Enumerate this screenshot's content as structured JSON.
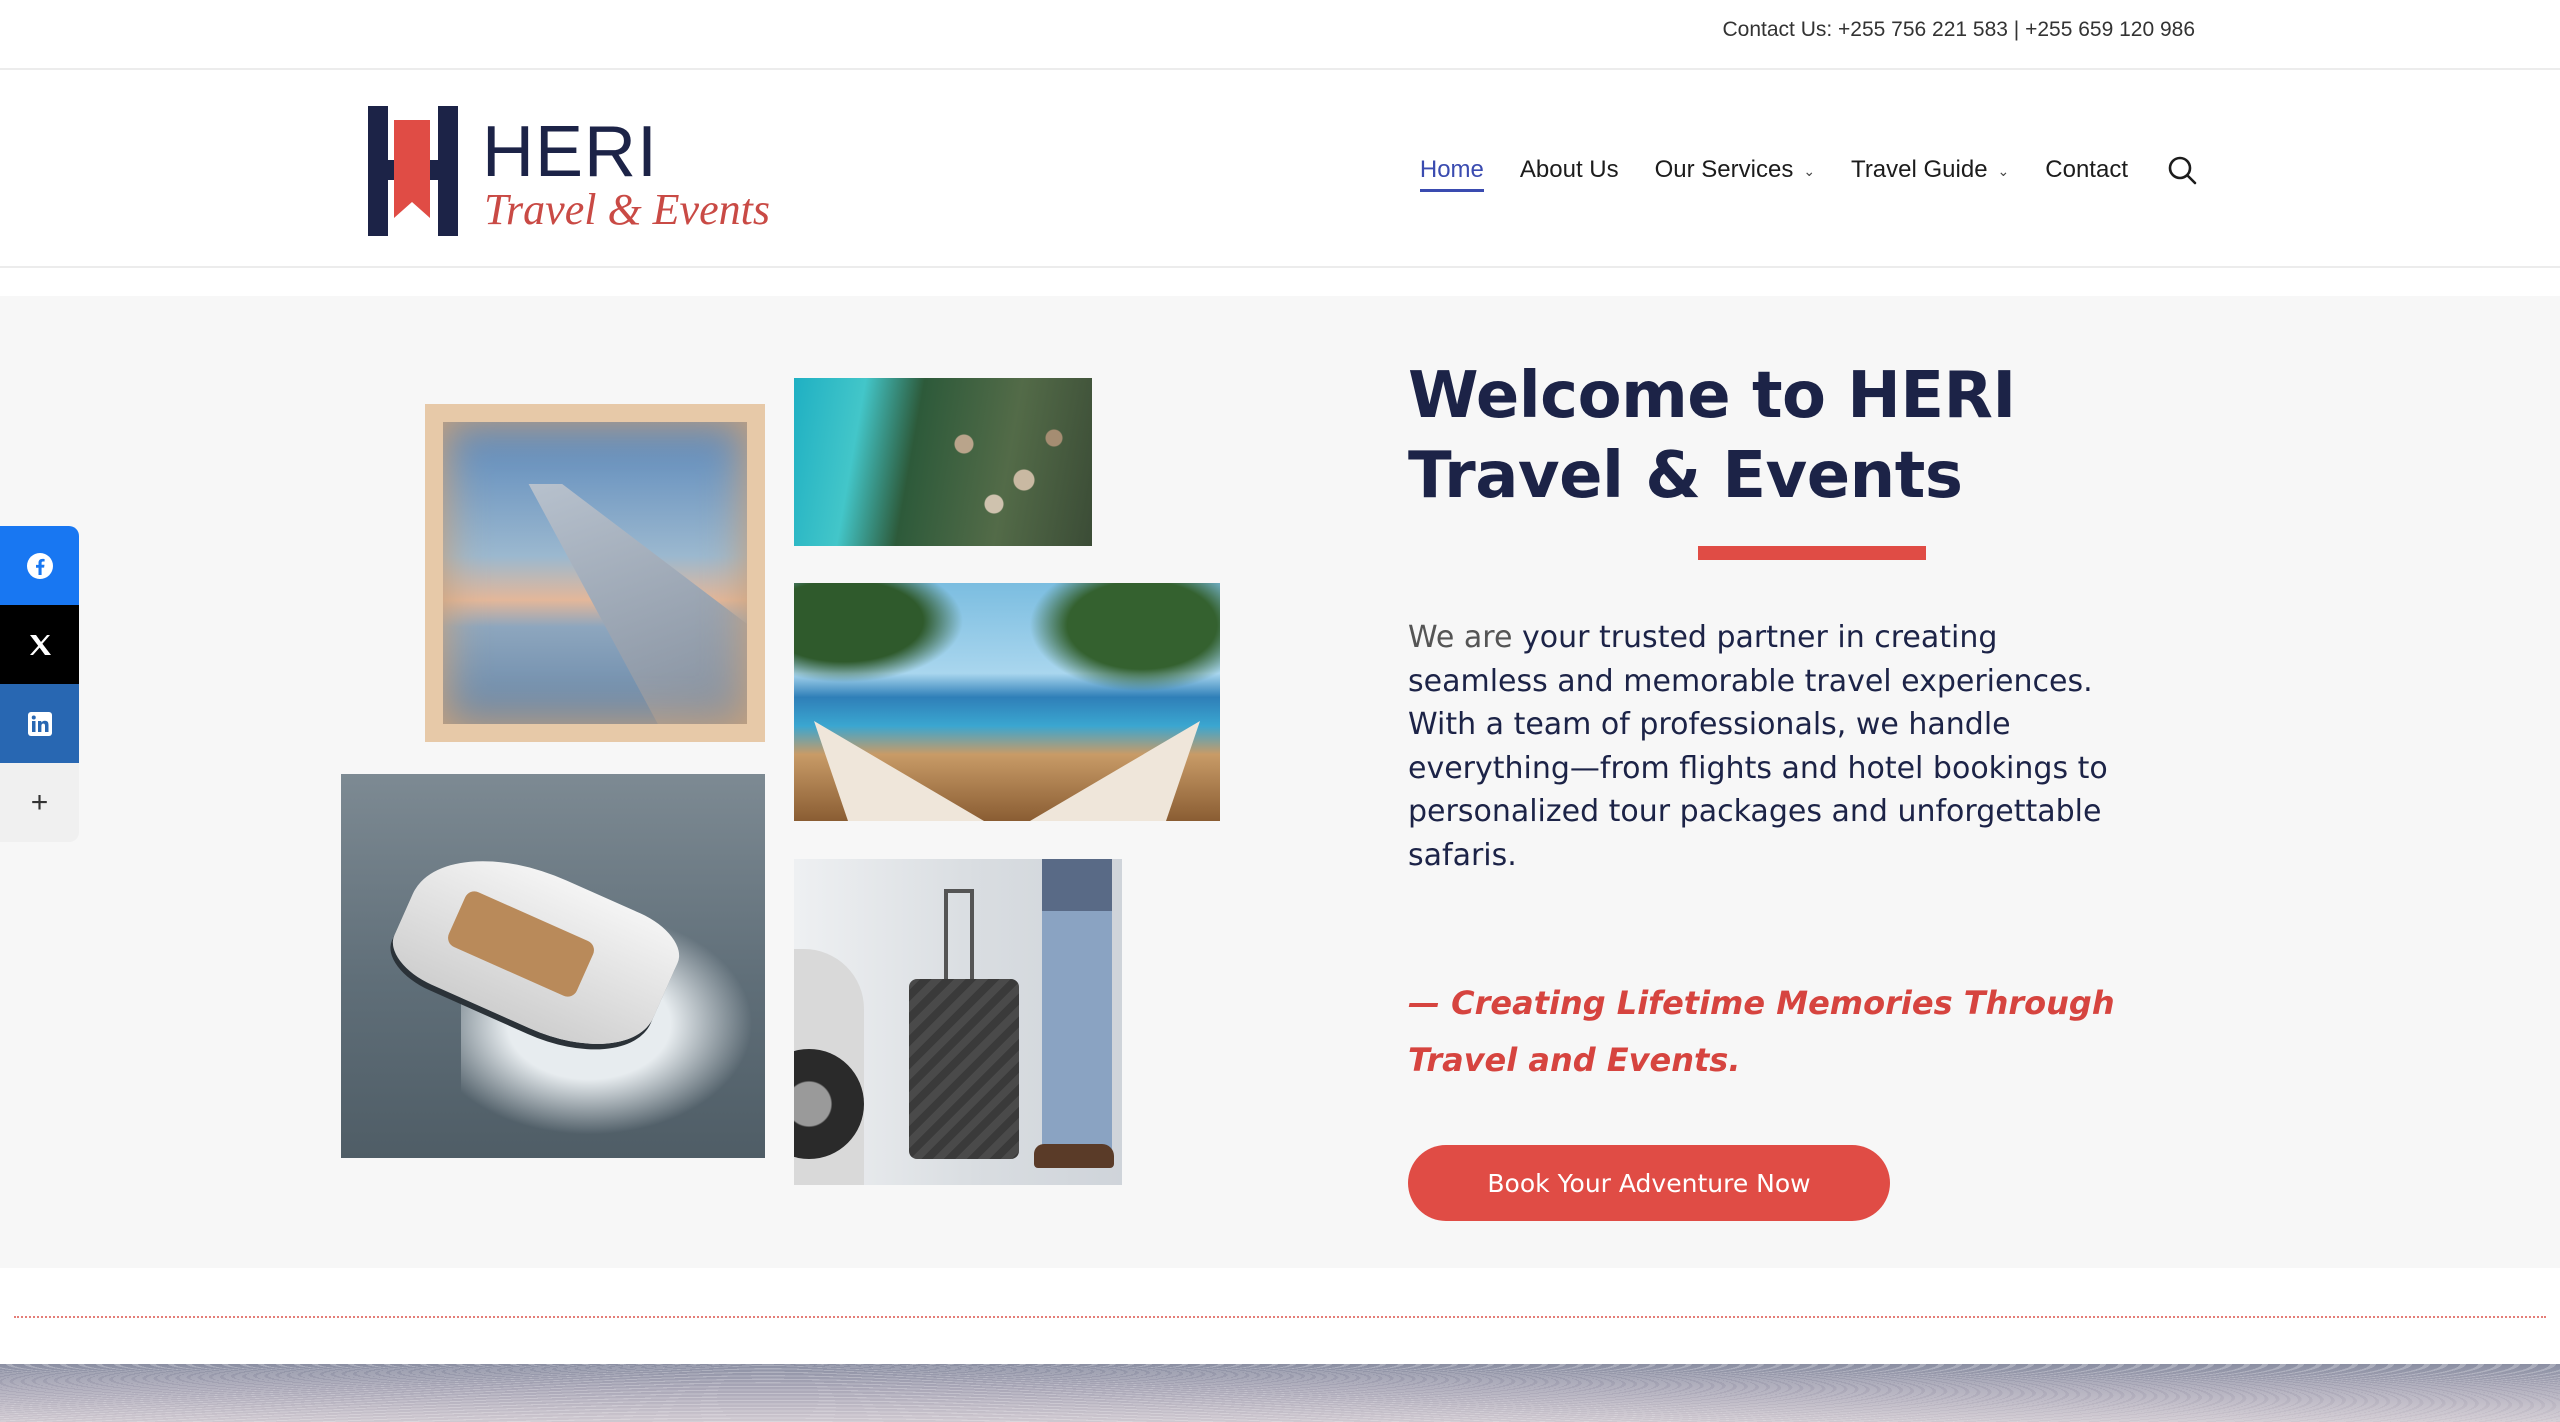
{
  "topbar": {
    "contact": "Contact Us: +255 756 221 583 | +255 659 120 986"
  },
  "logo": {
    "name": "HERI",
    "tagline": "Travel & Events"
  },
  "nav": {
    "items": [
      {
        "label": "Home",
        "active": true
      },
      {
        "label": "About Us"
      },
      {
        "label": "Our Services",
        "dropdown": true
      },
      {
        "label": "Travel Guide",
        "dropdown": true
      },
      {
        "label": "Contact"
      }
    ]
  },
  "hero": {
    "title": "Welcome to HERI Travel & Events",
    "body_lead": "We are",
    "body_rest": " your trusted partner in creating seamless and memorable travel experiences. With a team of professionals, we handle everything—from flights and hotel bookings to personalized tour packages and unforgettable safaris.",
    "quote": "— Creating Lifetime Memories Through Travel and Events.",
    "cta": "Book Your Adventure Now"
  },
  "social": {
    "items": [
      "facebook-icon",
      "x-icon",
      "linkedin-icon",
      "plus-icon"
    ]
  },
  "colors": {
    "navy": "#1c2347",
    "accent": "#e04c45",
    "active_link": "#3a4bb0"
  }
}
